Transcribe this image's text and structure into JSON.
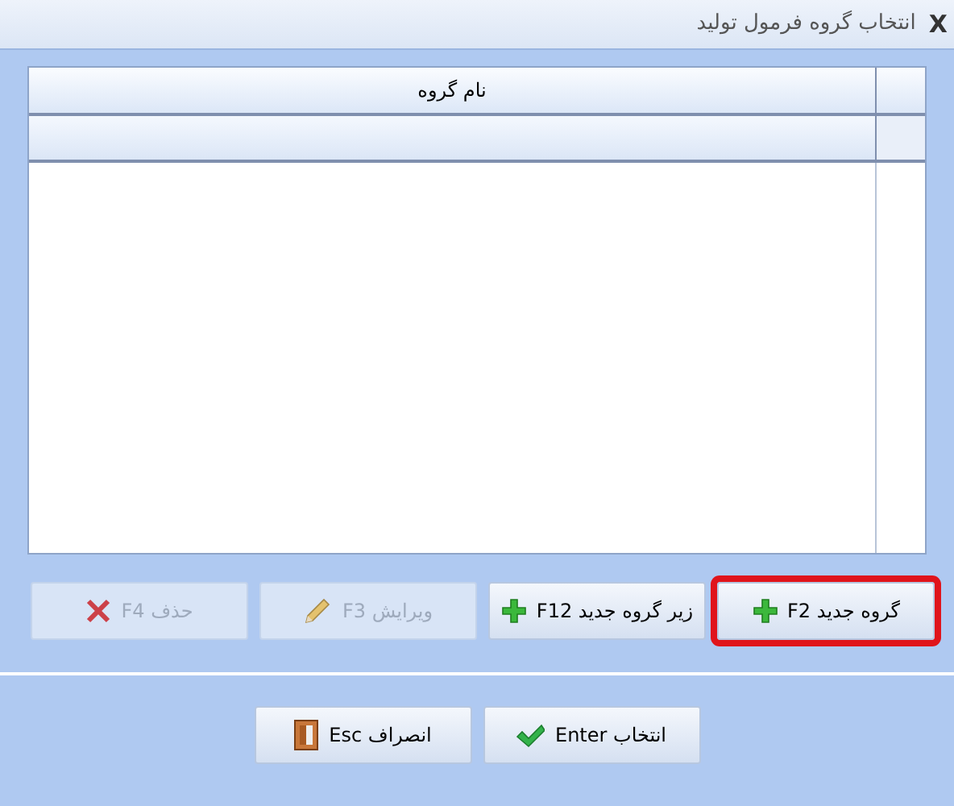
{
  "window": {
    "title": "انتخاب گروه فرمول تولید",
    "close": "X"
  },
  "table": {
    "columns": [
      "نام گروه"
    ]
  },
  "action_buttons": [
    {
      "label": "گروه جدید F2",
      "kind": "add",
      "disabled": false,
      "highlighted": true
    },
    {
      "label": "زیر گروه جدید F12",
      "kind": "add",
      "disabled": false,
      "highlighted": false
    },
    {
      "label": "ویرایش F3",
      "kind": "edit",
      "disabled": true,
      "highlighted": false
    },
    {
      "label": "حذف F4",
      "kind": "delete",
      "disabled": true,
      "highlighted": false
    }
  ],
  "dialog_buttons": [
    {
      "label": "انتخاب Enter",
      "kind": "confirm"
    },
    {
      "label": "انصراف Esc",
      "kind": "cancel"
    }
  ]
}
